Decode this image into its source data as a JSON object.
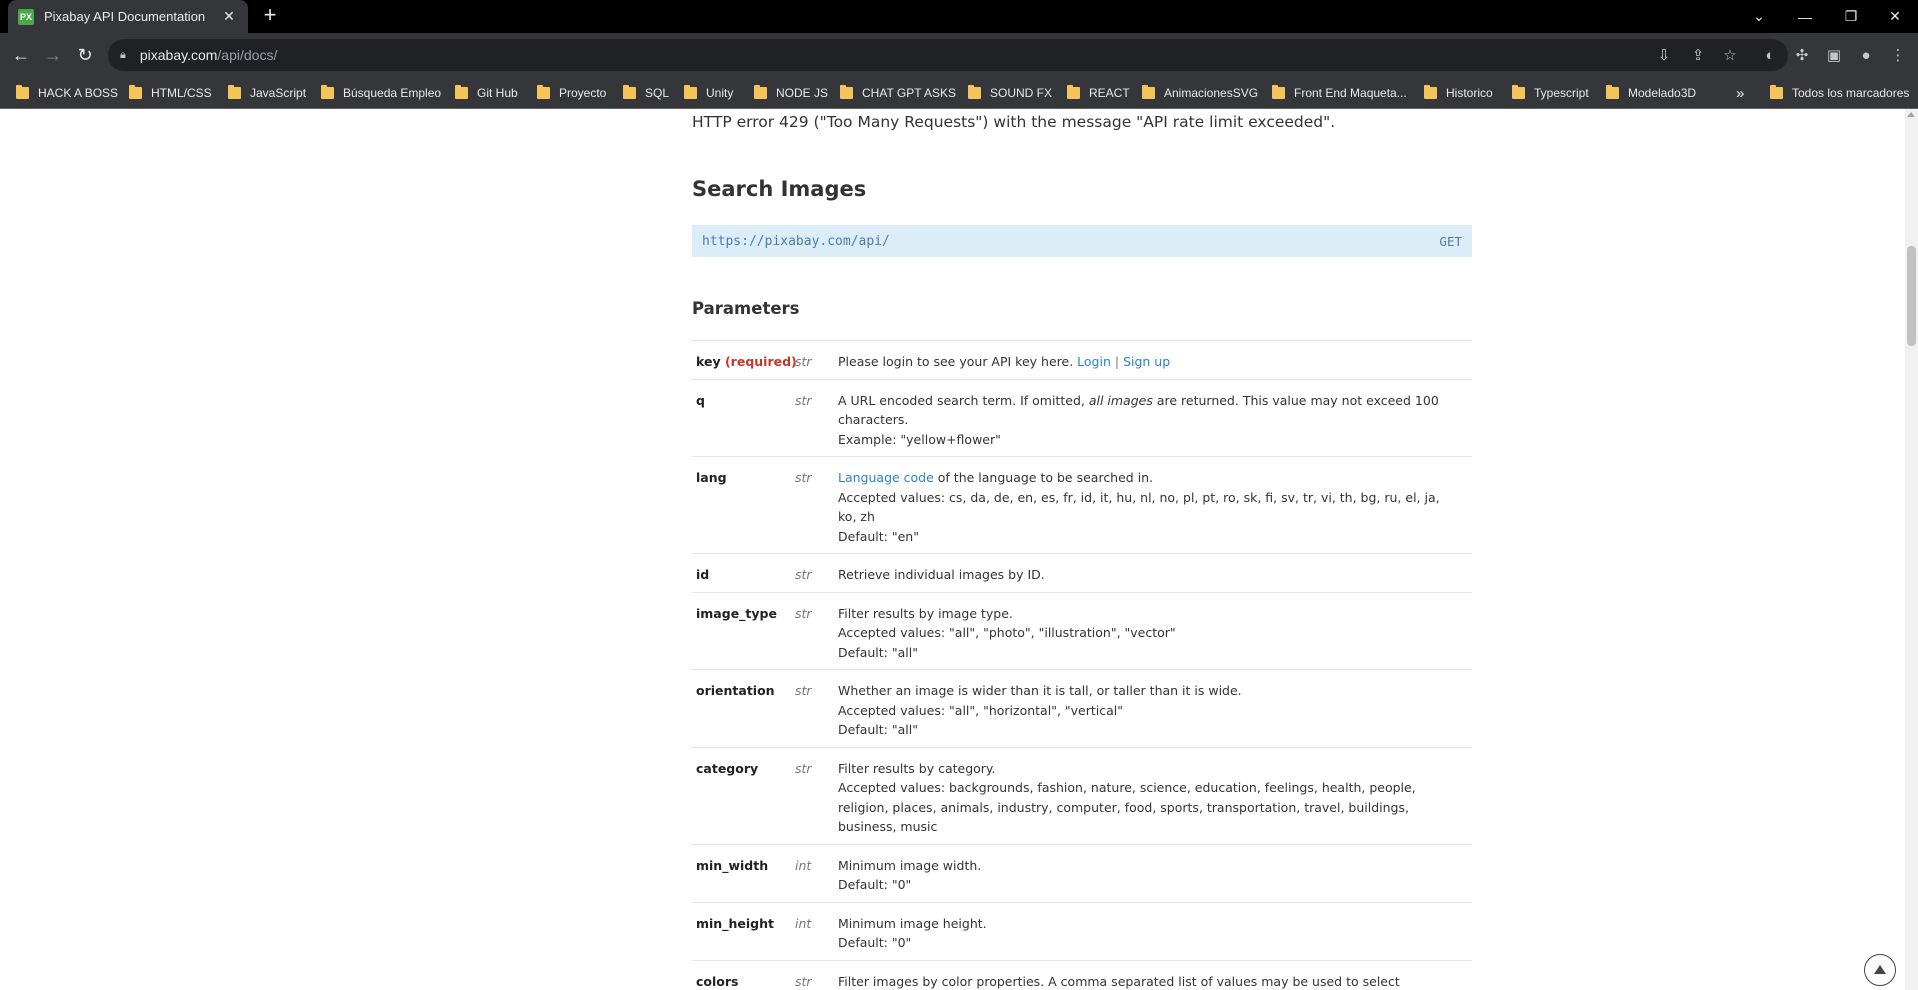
{
  "browser": {
    "tab_title": "Pixabay API Documentation",
    "tab_favicon": "PX",
    "url_host": "pixabay.com",
    "url_path": "/api/docs/",
    "accent": "#48a947"
  },
  "bookmarks": [
    "HACK A BOSS",
    "HTML/CSS",
    "JavaScript",
    "Búsqueda Empleo",
    "Git Hub",
    "Proyecto",
    "SQL",
    "Unity",
    "NODE JS",
    "CHAT GPT ASKS",
    "SOUND FX",
    "REACT",
    "AnimacionesSVG",
    "Front End Maqueta...",
    "Historico",
    "Typescript",
    "Modelado3D"
  ],
  "bookmarks_overflow": "»",
  "bookmarks_all": "Todos los marcadores",
  "page": {
    "intro_line": "HTTP error 429 (\"Too Many Requests\") with the message \"API rate limit exceeded\".",
    "search_heading": "Search Images",
    "endpoint_url": "https://pixabay.com/api/",
    "endpoint_method": "GET",
    "params_heading": "Parameters",
    "params": [
      {
        "name": "key",
        "required": "(required)",
        "type": "str",
        "text1": "Please login to see your API key here. ",
        "link1": "Login",
        "sep": " | ",
        "link2": "Sign up"
      },
      {
        "name": "q",
        "type": "str",
        "d_pre": "A URL encoded search term. If omitted, ",
        "d_em": "all images",
        "d_post": " are returned. This value may not exceed 100 characters.",
        "line2": "Example: \"yellow+flower\""
      },
      {
        "name": "lang",
        "type": "str",
        "link": "Language code",
        "line1_rest": " of the language to be searched in.",
        "line2": "Accepted values: cs, da, de, en, es, fr, id, it, hu, nl, no, pl, pt, ro, sk, fi, sv, tr, vi, th, bg, ru, el, ja, ko, zh",
        "line3": "Default: \"en\""
      },
      {
        "name": "id",
        "type": "str",
        "line1": "Retrieve individual images by ID."
      },
      {
        "name": "image_type",
        "type": "str",
        "line1": "Filter results by image type.",
        "line2": "Accepted values: \"all\", \"photo\", \"illustration\", \"vector\"",
        "line3": "Default: \"all\""
      },
      {
        "name": "orientation",
        "type": "str",
        "line1": "Whether an image is wider than it is tall, or taller than it is wide.",
        "line2": "Accepted values: \"all\", \"horizontal\", \"vertical\"",
        "line3": "Default: \"all\""
      },
      {
        "name": "category",
        "type": "str",
        "line1": "Filter results by category.",
        "line2": "Accepted values: backgrounds, fashion, nature, science, education, feelings, health, people, religion, places, animals, industry, computer, food, sports, transportation, travel, buildings, business, music"
      },
      {
        "name": "min_width",
        "type": "int",
        "line1": "Minimum image width.",
        "line2": "Default: \"0\""
      },
      {
        "name": "min_height",
        "type": "int",
        "line1": "Minimum image height.",
        "line2": "Default: \"0\""
      },
      {
        "name": "colors",
        "type": "str",
        "line1": "Filter images by color properties. A comma separated list of values may be used to select multiple properties."
      }
    ]
  }
}
